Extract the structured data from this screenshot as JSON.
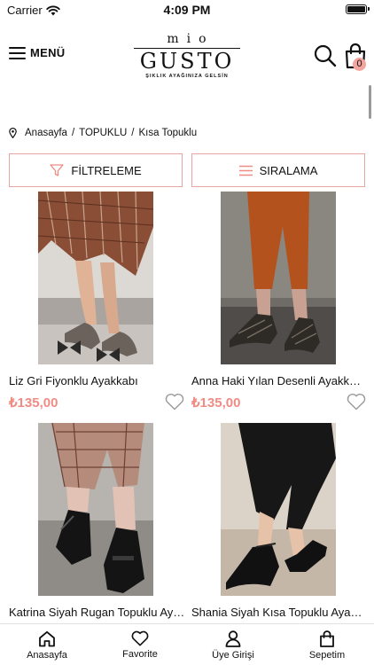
{
  "status_bar": {
    "carrier": "Carrier",
    "time": "4:09 PM"
  },
  "header": {
    "menu_label": "MENÜ",
    "logo_top": "mio",
    "logo_main": "GUSTO",
    "logo_tagline": "ŞIKLIK AYAĞINIZA GELSİN",
    "cart_count": "0"
  },
  "breadcrumb": {
    "items": [
      "Anasayfa",
      "TOPUKLU",
      "Kısa Topuklu"
    ]
  },
  "toolbar": {
    "filter_label": "FİLTRELEME",
    "sort_label": "SIRALAMA"
  },
  "products": [
    {
      "name": "Liz Gri Fiyonklu Ayakkabı",
      "price": "₺135,00"
    },
    {
      "name": "Anna Haki Yılan Desenli Ayakkabı",
      "price": "₺135,00"
    },
    {
      "name": "Katrina Siyah Rugan Topuklu Ayakkabı",
      "price": ""
    },
    {
      "name": "Shania Siyah Kısa Topuklu Ayakkabı",
      "price": ""
    }
  ],
  "tabbar": {
    "tabs": [
      {
        "label": "Anasayfa",
        "icon": "home-icon"
      },
      {
        "label": "Favorite",
        "icon": "heart-icon"
      },
      {
        "label": "Üye Girişi",
        "icon": "user-icon"
      },
      {
        "label": "Sepetim",
        "icon": "bag-icon"
      }
    ]
  },
  "colors": {
    "accent": "#ef8c84",
    "border_accent": "#e8a49e",
    "badge": "#f3a59f"
  }
}
